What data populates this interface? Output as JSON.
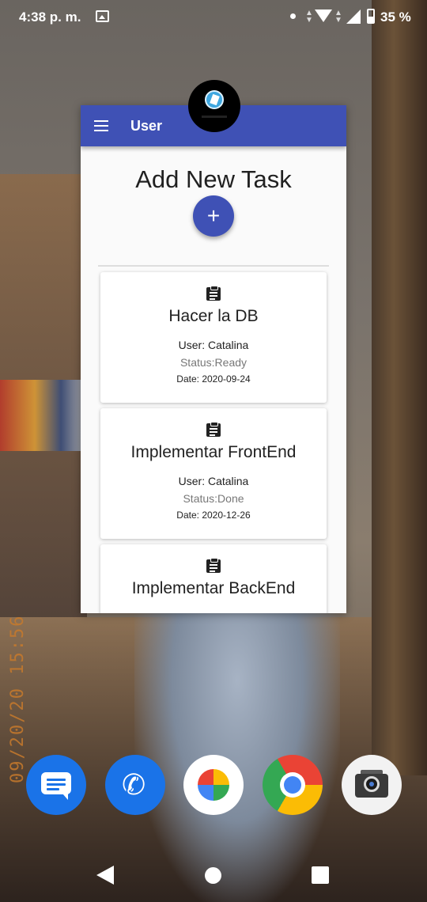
{
  "status_bar": {
    "time": "4:38 p. m.",
    "battery_percent": "35 %",
    "icons": [
      "image-notification-icon",
      "dot-icon",
      "wifi-icon",
      "cell-signal-icon",
      "battery-icon"
    ]
  },
  "wallpaper": {
    "timestamp_overlay": "09/20/20 15:56"
  },
  "app": {
    "title": "User",
    "menu_icon": "hamburger-menu-icon",
    "heading": "Add New Task",
    "fab_label": "+",
    "accent_color": "#3f51b5",
    "tasks": [
      {
        "title": "Hacer la DB",
        "user": "User: Catalina",
        "status": "Status:Ready",
        "date": "Date: 2020-09-24",
        "icon": "clipboard-icon"
      },
      {
        "title": "Implementar FrontEnd",
        "user": "User: Catalina",
        "status": "Status:Done",
        "date": "Date: 2020-12-26",
        "icon": "clipboard-icon"
      },
      {
        "title": "Implementar BackEnd",
        "user": "",
        "status": "",
        "date": "",
        "icon": "clipboard-icon"
      }
    ]
  },
  "dock": {
    "apps": [
      "messages-app-icon",
      "phone-app-icon",
      "photos-app-icon",
      "chrome-app-icon",
      "camera-app-icon"
    ]
  },
  "nav_bar": {
    "buttons": [
      "back-button",
      "home-button",
      "recents-button"
    ]
  }
}
